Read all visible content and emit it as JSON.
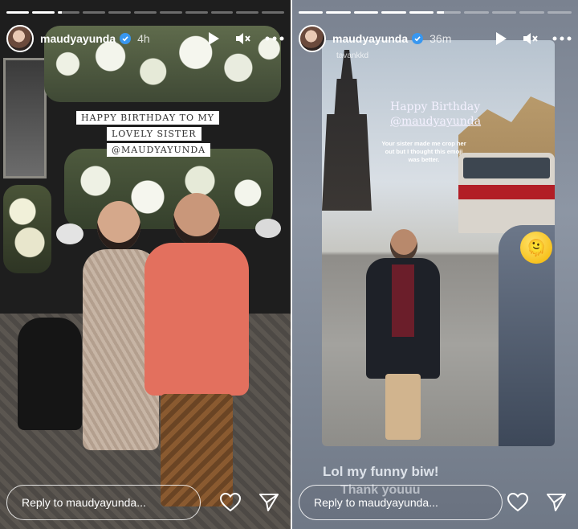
{
  "stories": [
    {
      "username": "maudyayunda",
      "time": "4h",
      "progress": [
        1,
        1,
        0.2,
        0,
        0,
        0,
        0,
        0,
        0,
        0,
        0
      ],
      "banner_lines": [
        "HAPPY BIRTHDAY TO MY",
        "LOVELY SISTER",
        "@MAUDYAYUNDA"
      ],
      "reply_placeholder": "Reply to maudyayunda..."
    },
    {
      "username": "maudyayunda",
      "time": "36m",
      "progress": [
        1,
        1,
        1,
        1,
        1,
        0.3,
        0,
        0,
        0,
        0
      ],
      "handle": "tavankkd",
      "hb_title": "Happy Birthday",
      "hb_mention": "@maudyayunda",
      "hb_note": "Your sister made me crop her out but I thought this emoji was better.",
      "emoji": "🫠",
      "caption1": "Lol my funny biw!",
      "caption2": "Thank youuu",
      "reply_placeholder": "Reply to maudyayunda..."
    }
  ],
  "icons": [
    "verified-badge-icon",
    "play-icon",
    "mute-icon",
    "more-icon",
    "heart-icon",
    "send-icon"
  ],
  "colors": {
    "verified": "#3897f0",
    "story1_bg": "#1e1e1e",
    "story2_bg": "#8d96a4"
  }
}
